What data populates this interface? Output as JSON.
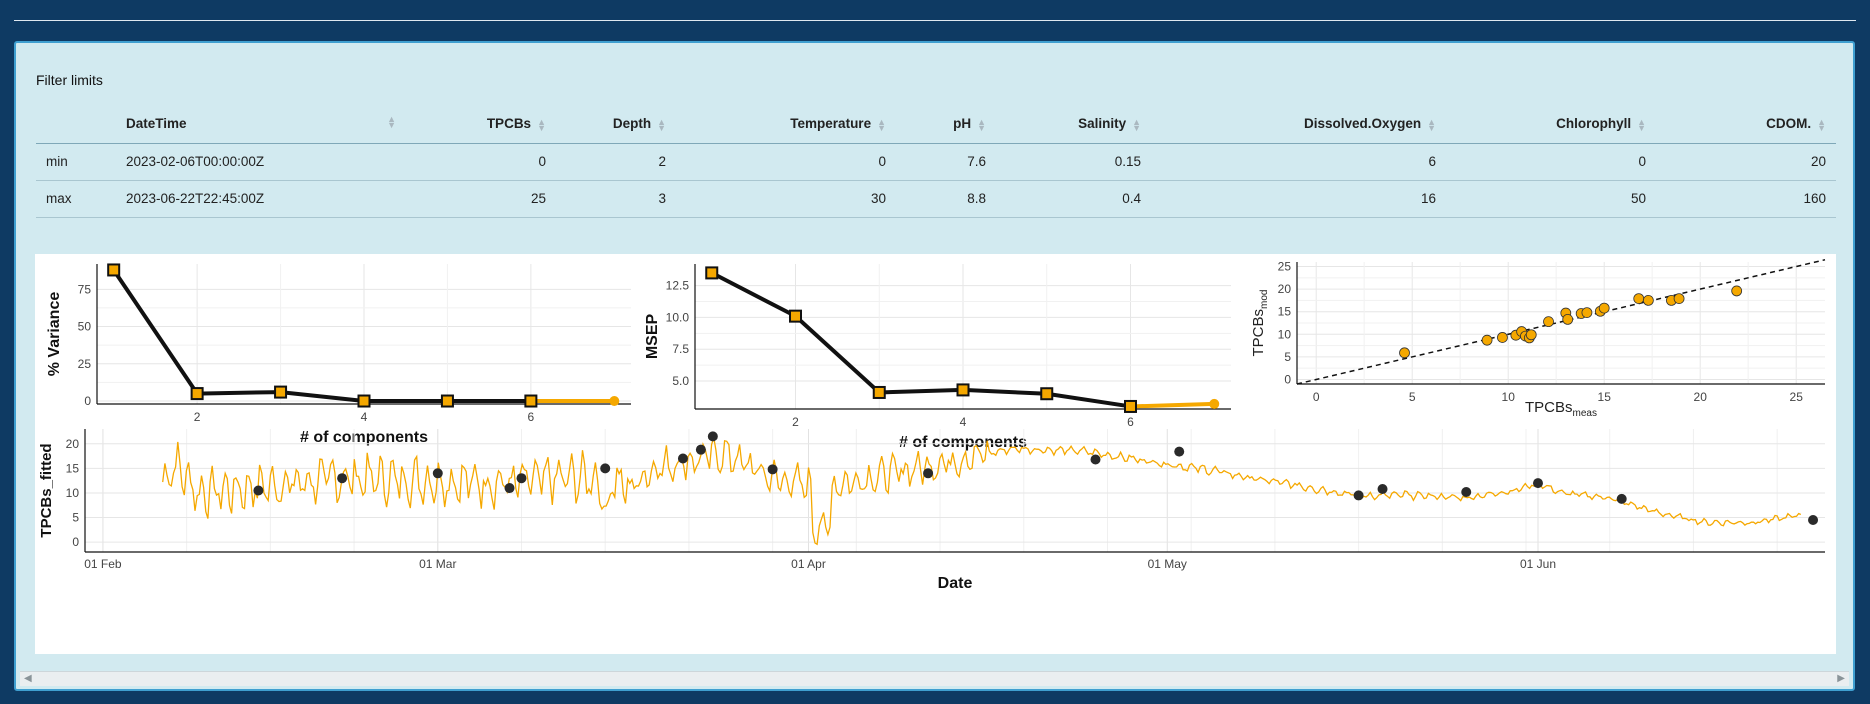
{
  "filter": {
    "title": "Filter limits",
    "columns": [
      "",
      "DateTime",
      "TPCBs",
      "Depth",
      "Temperature",
      "pH",
      "Salinity",
      "Dissolved.Oxygen",
      "Chlorophyll",
      "CDOM."
    ],
    "rows": [
      [
        "min",
        "2023-02-06T00:00:00Z",
        "0",
        "2",
        "0",
        "7.6",
        "0.15",
        "6",
        "0",
        "20"
      ],
      [
        "max",
        "2023-06-22T22:45:00Z",
        "25",
        "3",
        "30",
        "8.8",
        "0.4",
        "16",
        "50",
        "160"
      ]
    ]
  },
  "colors": {
    "accent": "#f5a800",
    "line": "#111111",
    "page_bg": "#0e3a63",
    "panel_bg": "#d2eaf0"
  },
  "chart_data": [
    {
      "type": "line",
      "xlabel": "# of components",
      "ylabel": "% Variance",
      "xlim": [
        0.8,
        7.2
      ],
      "ylim": [
        -2,
        92
      ],
      "xticks": [
        2,
        4,
        6
      ],
      "yticks": [
        0,
        25,
        50,
        75
      ],
      "series": [
        {
          "x": [
            1,
            2,
            3,
            4,
            5,
            6
          ],
          "values": [
            88,
            5,
            6,
            0,
            0,
            0
          ]
        }
      ],
      "tail": [
        [
          6,
          0
        ],
        [
          7,
          0
        ]
      ]
    },
    {
      "type": "line",
      "xlabel": "# of components",
      "ylabel": "MSEP",
      "xlim": [
        0.8,
        7.2
      ],
      "ylim": [
        2.8,
        14.2
      ],
      "xticks": [
        2,
        4,
        6
      ],
      "yticks": [
        5.0,
        7.5,
        10.0,
        12.5
      ],
      "series": [
        {
          "x": [
            1,
            2,
            3,
            4,
            5,
            6
          ],
          "values": [
            13.5,
            10.1,
            4.1,
            4.3,
            4.0,
            3.0
          ]
        }
      ],
      "tail": [
        [
          6,
          3.0
        ],
        [
          7,
          3.2
        ]
      ]
    },
    {
      "type": "scatter",
      "xlabel": "TPCBs",
      "xlabel_sub": "meas",
      "ylabel": "TPCBs",
      "ylabel_sub": "mod",
      "xlim": [
        -1,
        26.5
      ],
      "ylim": [
        -1,
        26
      ],
      "xticks": [
        0,
        5,
        10,
        15,
        20,
        25
      ],
      "yticks": [
        0,
        5,
        10,
        15,
        20,
        25
      ],
      "identity_line": true,
      "points": [
        [
          4.6,
          5.9
        ],
        [
          8.9,
          8.7
        ],
        [
          9.7,
          9.3
        ],
        [
          10.4,
          9.8
        ],
        [
          10.7,
          10.6
        ],
        [
          10.9,
          9.6
        ],
        [
          11.1,
          9.2
        ],
        [
          11.2,
          9.9
        ],
        [
          12.1,
          12.8
        ],
        [
          13.0,
          14.7
        ],
        [
          13.1,
          13.3
        ],
        [
          13.8,
          14.6
        ],
        [
          14.1,
          14.8
        ],
        [
          14.8,
          15.1
        ],
        [
          15.0,
          15.8
        ],
        [
          16.8,
          17.9
        ],
        [
          17.3,
          17.5
        ],
        [
          18.5,
          17.5
        ],
        [
          18.9,
          17.9
        ],
        [
          21.9,
          19.6
        ]
      ]
    },
    {
      "type": "line",
      "xlabel": "Date",
      "ylabel": "TPCBs_fitted",
      "ylim": [
        -2,
        23
      ],
      "yticks": [
        0,
        5,
        10,
        15,
        20
      ],
      "xlim_days": [
        -1.5,
        144
      ],
      "xticks": [
        "01 Feb",
        "01 Mar",
        "01 Apr",
        "01 May",
        "01 Jun"
      ],
      "xtick_days": [
        0,
        28,
        59,
        89,
        120
      ],
      "series_desc": "15-minute model fit, continuous line",
      "observations": [
        [
          13,
          10.5
        ],
        [
          20,
          13
        ],
        [
          28,
          14
        ],
        [
          34,
          11
        ],
        [
          35,
          13
        ],
        [
          42,
          15
        ],
        [
          48.5,
          17
        ],
        [
          50,
          18.8
        ],
        [
          51,
          21.5
        ],
        [
          56,
          14.8
        ],
        [
          69,
          14
        ],
        [
          83,
          16.8
        ],
        [
          90,
          18.4
        ],
        [
          105,
          9.5
        ],
        [
          107,
          10.8
        ],
        [
          114,
          10.2
        ],
        [
          120,
          12
        ],
        [
          127,
          8.8
        ],
        [
          143,
          4.5
        ]
      ]
    }
  ]
}
